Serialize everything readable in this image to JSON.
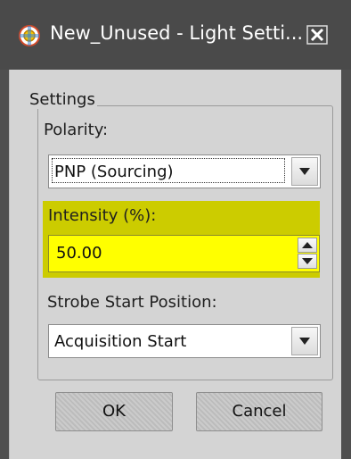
{
  "window": {
    "title": "New_Unused - Light Setti...",
    "close_glyph": "✕",
    "icon": "light-settings-icon"
  },
  "settings": {
    "legend": "Settings",
    "polarity": {
      "label": "Polarity:",
      "value": "PNP (Sourcing)"
    },
    "intensity": {
      "label": "Intensity (%):",
      "value": "50.00",
      "highlight_color": "#cccc00",
      "field_color": "#ffff00"
    },
    "strobe": {
      "label": "Strobe Start Position:",
      "value": "Acquisition Start"
    }
  },
  "buttons": {
    "ok": "OK",
    "cancel": "Cancel"
  }
}
